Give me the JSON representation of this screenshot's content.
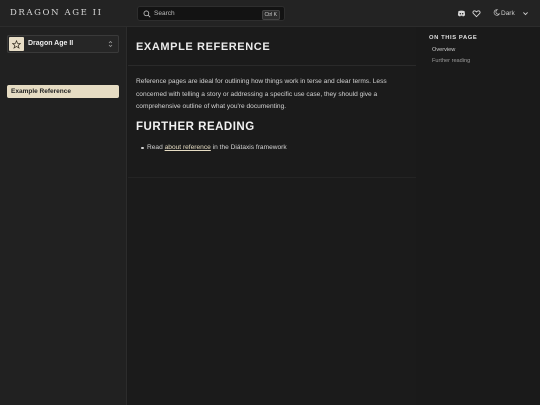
{
  "header": {
    "site_title": "DRAGON AGE II",
    "search_placeholder": "Search",
    "search_shortcut": "Ctrl K",
    "theme_label": "Dark"
  },
  "sidebar": {
    "project_name": "Dragon Age II",
    "active_item": "Example Reference"
  },
  "main": {
    "title": "EXAMPLE REFERENCE",
    "intro_text": "Reference pages are ideal for outlining how things work in terse and clear terms. Less concerned with telling a story or addressing a specific use case, they should give a comprehensive outline of what you're documenting.",
    "section_heading": "FURTHER READING",
    "bullet_prefix": "Read ",
    "bullet_link": "about reference",
    "bullet_suffix": " in the Diátaxis framework"
  },
  "toc": {
    "title": "ON THIS PAGE",
    "items": [
      "Overview",
      "Further reading"
    ]
  },
  "colors": {
    "accent": "#e6dcc3",
    "background": "#1b1b1b"
  }
}
